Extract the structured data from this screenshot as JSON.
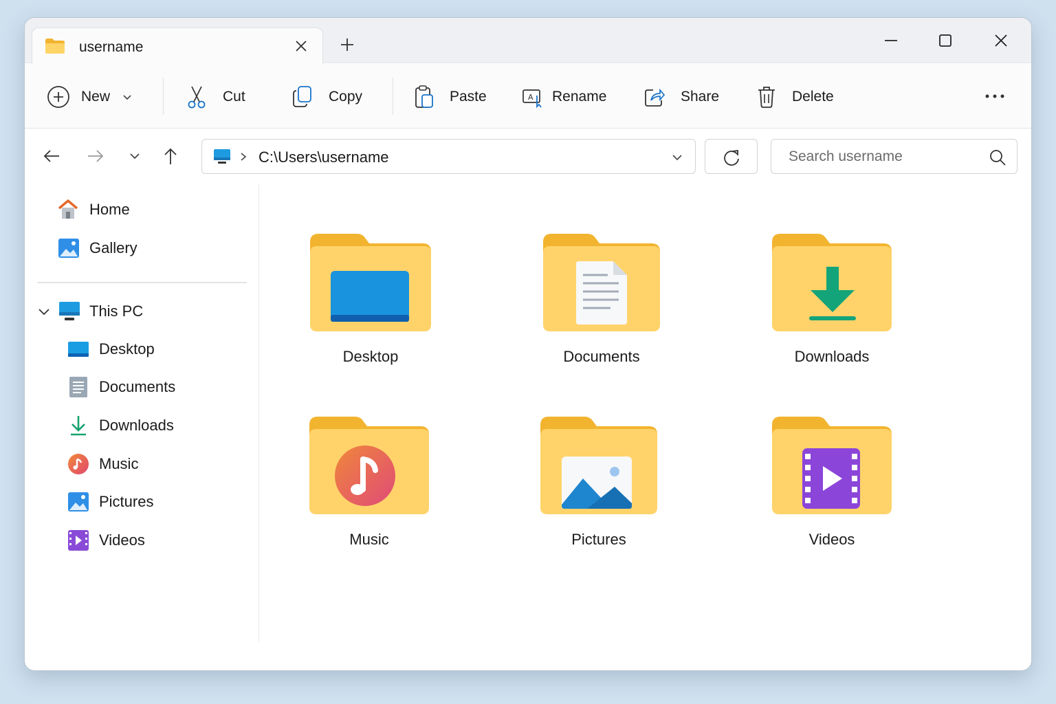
{
  "window": {
    "tab_title": "username",
    "accent": "#0067c0",
    "folder_color": "#f8c44c"
  },
  "commandbar": {
    "new": "New",
    "cut": "Cut",
    "copy": "Copy",
    "paste": "Paste",
    "rename": "Rename",
    "share": "Share",
    "delete": "Delete"
  },
  "address": {
    "path": "C:\\Users\\username",
    "search_placeholder": "Search username"
  },
  "sidebar": {
    "home": "Home",
    "gallery": "Gallery",
    "this_pc": "This PC",
    "items": [
      "Desktop",
      "Documents",
      "Downloads",
      "Music",
      "Pictures",
      "Videos"
    ]
  },
  "folders": [
    {
      "label": "Desktop",
      "icon": "desktop-icon"
    },
    {
      "label": "Documents",
      "icon": "document-icon"
    },
    {
      "label": "Downloads",
      "icon": "download-icon"
    },
    {
      "label": "Music",
      "icon": "music-icon"
    },
    {
      "label": "Pictures",
      "icon": "picture-icon"
    },
    {
      "label": "Videos",
      "icon": "video-icon"
    }
  ]
}
